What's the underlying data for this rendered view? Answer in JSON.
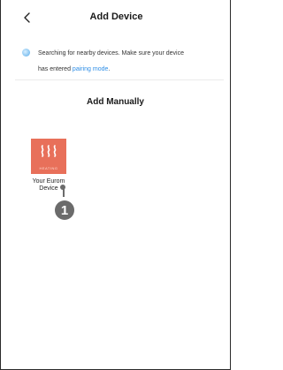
{
  "header": {
    "title": "Add Device",
    "back_icon": "chevron-left-icon"
  },
  "search_status": {
    "icon": "loading-spinner-icon",
    "line1": "Searching for nearby devices. Make sure your device",
    "line2_prefix": "has entered ",
    "link_text": "pairing mode",
    "line2_suffix": "."
  },
  "manual": {
    "title": "Add Manually",
    "devices": [
      {
        "icon": "heating-icon",
        "icon_caption": "HEATING",
        "name_line1": "Your Eurom",
        "name_line2": "Device"
      }
    ]
  },
  "annotation": {
    "badge": "1"
  },
  "colors": {
    "accent_link": "#2e8ee6",
    "device_tile": "#e8705a",
    "annotation": "#6b6b6b"
  }
}
